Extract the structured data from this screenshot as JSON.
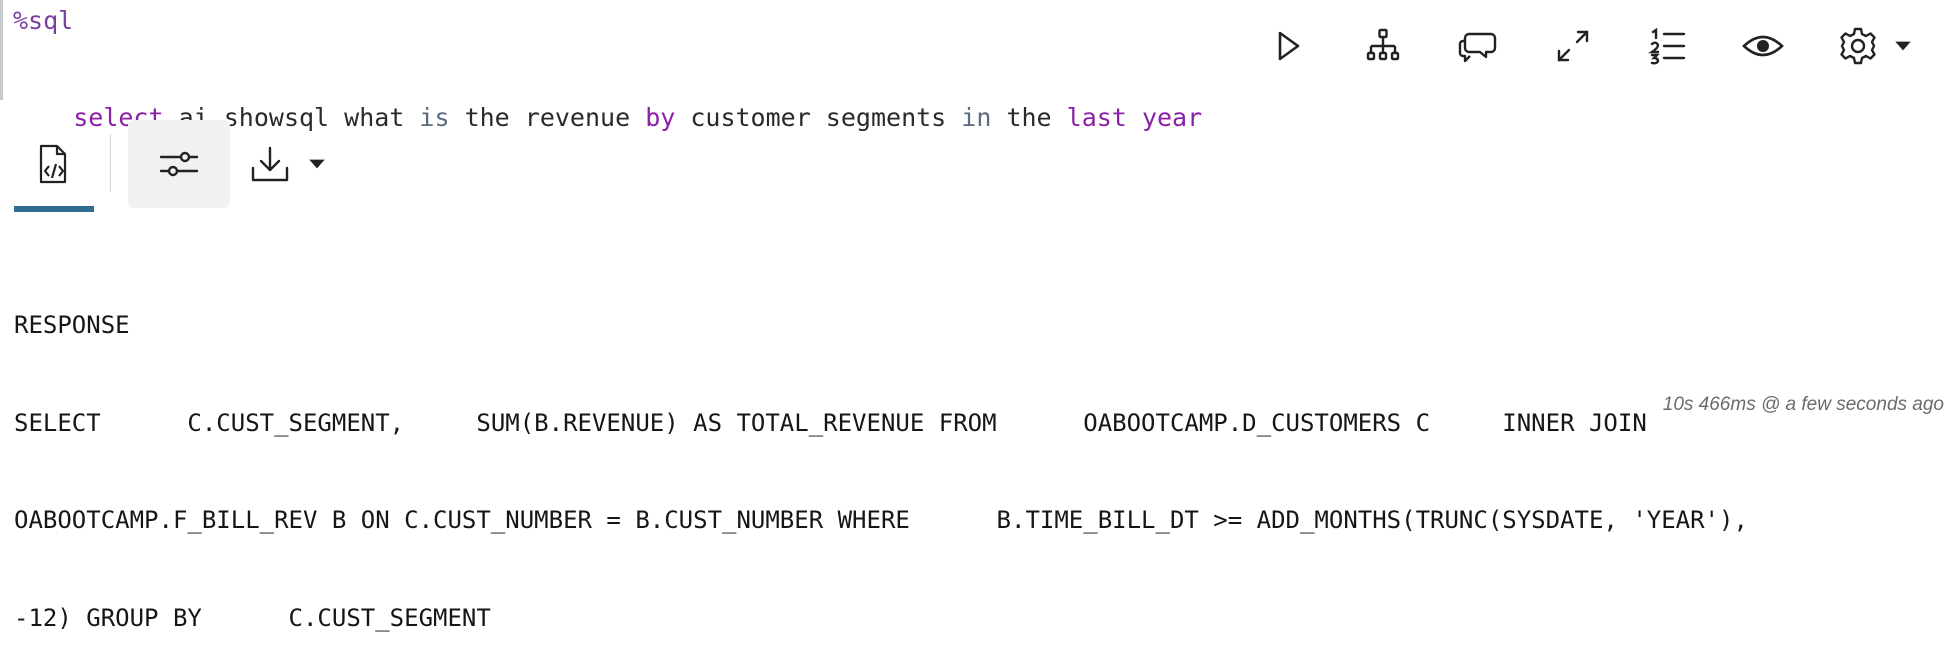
{
  "cell": {
    "magic": "%sql",
    "query_tokens": [
      {
        "text": "select",
        "kind": "kw"
      },
      {
        "text": " ai showsql what ",
        "kind": "plain"
      },
      {
        "text": "is",
        "kind": "op"
      },
      {
        "text": " the revenue ",
        "kind": "plain"
      },
      {
        "text": "by",
        "kind": "kw"
      },
      {
        "text": " customer segments ",
        "kind": "plain"
      },
      {
        "text": "in",
        "kind": "op"
      },
      {
        "text": " the ",
        "kind": "plain"
      },
      {
        "text": "last",
        "kind": "kw"
      },
      {
        "text": " ",
        "kind": "plain"
      },
      {
        "text": "year",
        "kind": "kw"
      }
    ]
  },
  "toolbar": {
    "icons": [
      "play-icon",
      "network-icon",
      "chat-bubbles-icon",
      "expand-icon",
      "numbered-list-icon",
      "eye-icon",
      "gear-icon",
      "caret-down-icon"
    ]
  },
  "result_tabs": {
    "icons": [
      "sql-file-icon",
      "sliders-icon",
      "download-icon",
      "caret-down-icon"
    ]
  },
  "output": {
    "lines": [
      "RESPONSE",
      "SELECT      C.CUST_SEGMENT,     SUM(B.REVENUE) AS TOTAL_REVENUE FROM      OABOOTCAMP.D_CUSTOMERS C     INNER JOIN",
      "OABOOTCAMP.F_BILL_REV B ON C.CUST_NUMBER = B.CUST_NUMBER WHERE      B.TIME_BILL_DT >= ADD_MONTHS(TRUNC(SYSDATE, 'YEAR'),",
      "-12) GROUP BY      C.CUST_SEGMENT"
    ]
  },
  "status": {
    "timing": "10s 466ms @ a few seconds ago"
  },
  "colors": {
    "keyword": "#8b1fa5",
    "operator": "#5b6b80",
    "tab_underline": "#2e6d8f"
  }
}
